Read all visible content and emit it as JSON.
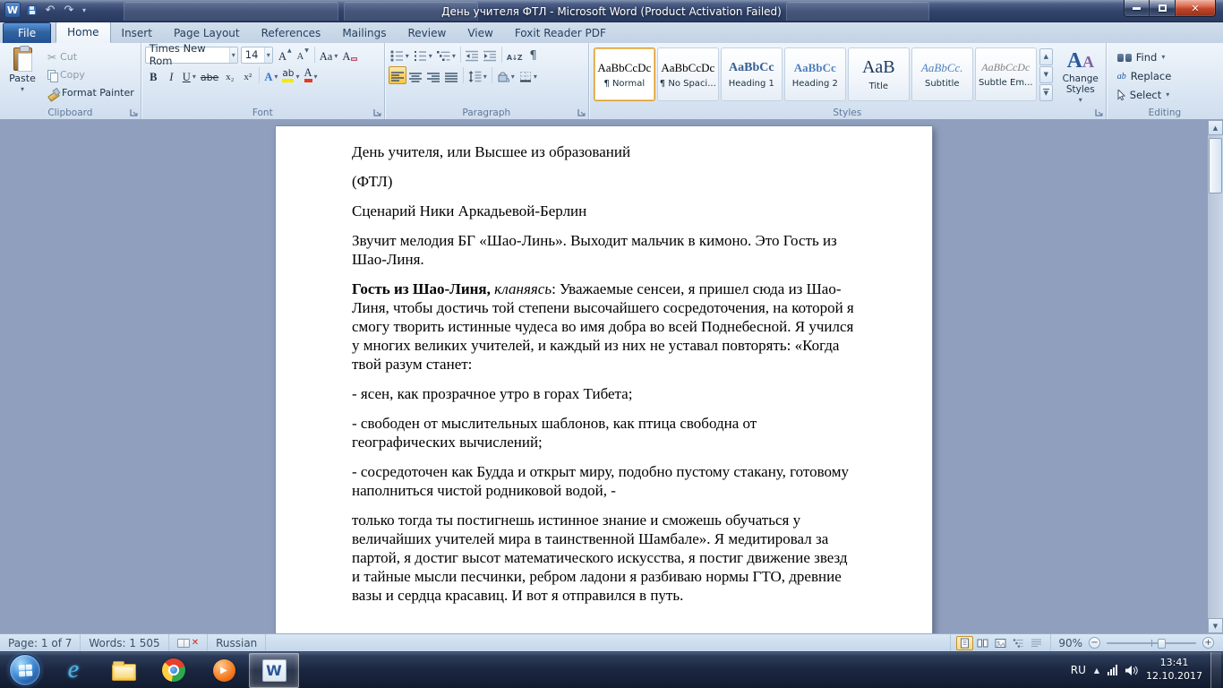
{
  "icons": {
    "dropdown": "▾",
    "up_arrow": "▲",
    "down_arrow": "▼",
    "undo": "↶",
    "redo": "↷",
    "scissors": "✂",
    "pilcrow": "¶",
    "close": "✕",
    "play": "▶",
    "word_logo": "W",
    "ie_logo": "e",
    "sort": "A↓Z"
  },
  "window": {
    "title": "День учителя ФТЛ - Microsoft Word (Product Activation Failed)"
  },
  "ribbon": {
    "tabs": [
      {
        "label": "File",
        "file": true
      },
      {
        "label": "Home",
        "active": true
      },
      {
        "label": "Insert"
      },
      {
        "label": "Page Layout"
      },
      {
        "label": "References"
      },
      {
        "label": "Mailings"
      },
      {
        "label": "Review"
      },
      {
        "label": "View"
      },
      {
        "label": "Foxit Reader PDF"
      }
    ],
    "clipboard": {
      "label": "Clipboard",
      "paste": "Paste",
      "cut": "Cut",
      "copy": "Copy",
      "format_painter": "Format Painter"
    },
    "font": {
      "label": "Font",
      "name": "Times New Rom",
      "size": "14",
      "bold": "B",
      "italic": "I",
      "underline": "U",
      "strikethrough": "abe",
      "subscript": "x₂",
      "superscript": "x²",
      "grow": "A",
      "shrink": "A",
      "change_case": "Aa",
      "clear": "A",
      "effects": "A",
      "highlight": "ab",
      "color": "A"
    },
    "paragraph": {
      "label": "Paragraph"
    },
    "styles": {
      "label": "Styles",
      "change_styles": "Change Styles",
      "items": [
        {
          "preview": "AaBbCcDc",
          "name": "¶ Normal",
          "style": "normal",
          "selected": true
        },
        {
          "preview": "AaBbCcDc",
          "name": "¶ No Spaci...",
          "style": "normal"
        },
        {
          "preview": "AaBbCc",
          "name": "Heading 1",
          "style": "heading1"
        },
        {
          "preview": "AaBbCc",
          "name": "Heading 2",
          "style": "heading2"
        },
        {
          "preview": "AaB",
          "name": "Title",
          "style": "title"
        },
        {
          "preview": "AaBbCc.",
          "name": "Subtitle",
          "style": "subtitle"
        },
        {
          "preview": "AaBbCcDc",
          "name": "Subtle Em...",
          "style": "subtle"
        }
      ]
    },
    "editing": {
      "label": "Editing",
      "find": "Find",
      "replace": "Replace",
      "select": "Select"
    }
  },
  "document": {
    "paragraphs": [
      {
        "runs": [
          {
            "text": "День учителя, или Высшее из образований"
          }
        ]
      },
      {
        "runs": [
          {
            "text": "(ФТЛ)"
          }
        ]
      },
      {
        "runs": [
          {
            "text": "Сценарий Ники Аркадьевой-Берлин"
          }
        ]
      },
      {
        "runs": [
          {
            "text": "Звучит мелодия БГ «Шао-Линь». Выходит мальчик в кимоно. Это Гость из Шао-Линя."
          }
        ]
      },
      {
        "runs": [
          {
            "text": "Гость из Шао-Линя, ",
            "bold": true
          },
          {
            "text": "кланяясь",
            "italic": true
          },
          {
            "text": ": Уважаемые сенсеи, я пришел сюда из Шао-Линя, чтобы достичь той степени высочайшего сосредоточения, на которой я смогу творить истинные чудеса во имя добра во всей Поднебесной. Я учился у многих великих учителей, и каждый из них не уставал повторять: «Когда твой разум станет:"
          }
        ]
      },
      {
        "runs": [
          {
            "text": "- ясен, как прозрачное утро в горах Тибета;"
          }
        ]
      },
      {
        "runs": [
          {
            "text": "- свободен от мыслительных шаблонов, как птица свободна от географических вычислений;"
          }
        ]
      },
      {
        "runs": [
          {
            "text": "- сосредоточен как Будда и открыт миру, подобно пустому стакану, готовому наполниться чистой родниковой водой, -"
          }
        ]
      },
      {
        "runs": [
          {
            "text": "только тогда ты постигнешь истинное знание и сможешь обучаться у величайших учителей мира в таинственной Шамбале». Я медитировал за партой, я достиг высот математического искусства, я постиг движение звезд и тайные мысли песчинки, ребром ладони я разбиваю нормы ГТО, древние вазы и сердца красавиц. И вот я отправился в путь."
          }
        ]
      }
    ]
  },
  "status_bar": {
    "page": "Page: 1 of 7",
    "words": "Words: 1 505",
    "language": "Russian",
    "zoom": "90%",
    "zoom_out": "−",
    "zoom_in": "+"
  },
  "taskbar": {
    "language": "RU",
    "time": "13:41",
    "date": "12.10.2017"
  }
}
